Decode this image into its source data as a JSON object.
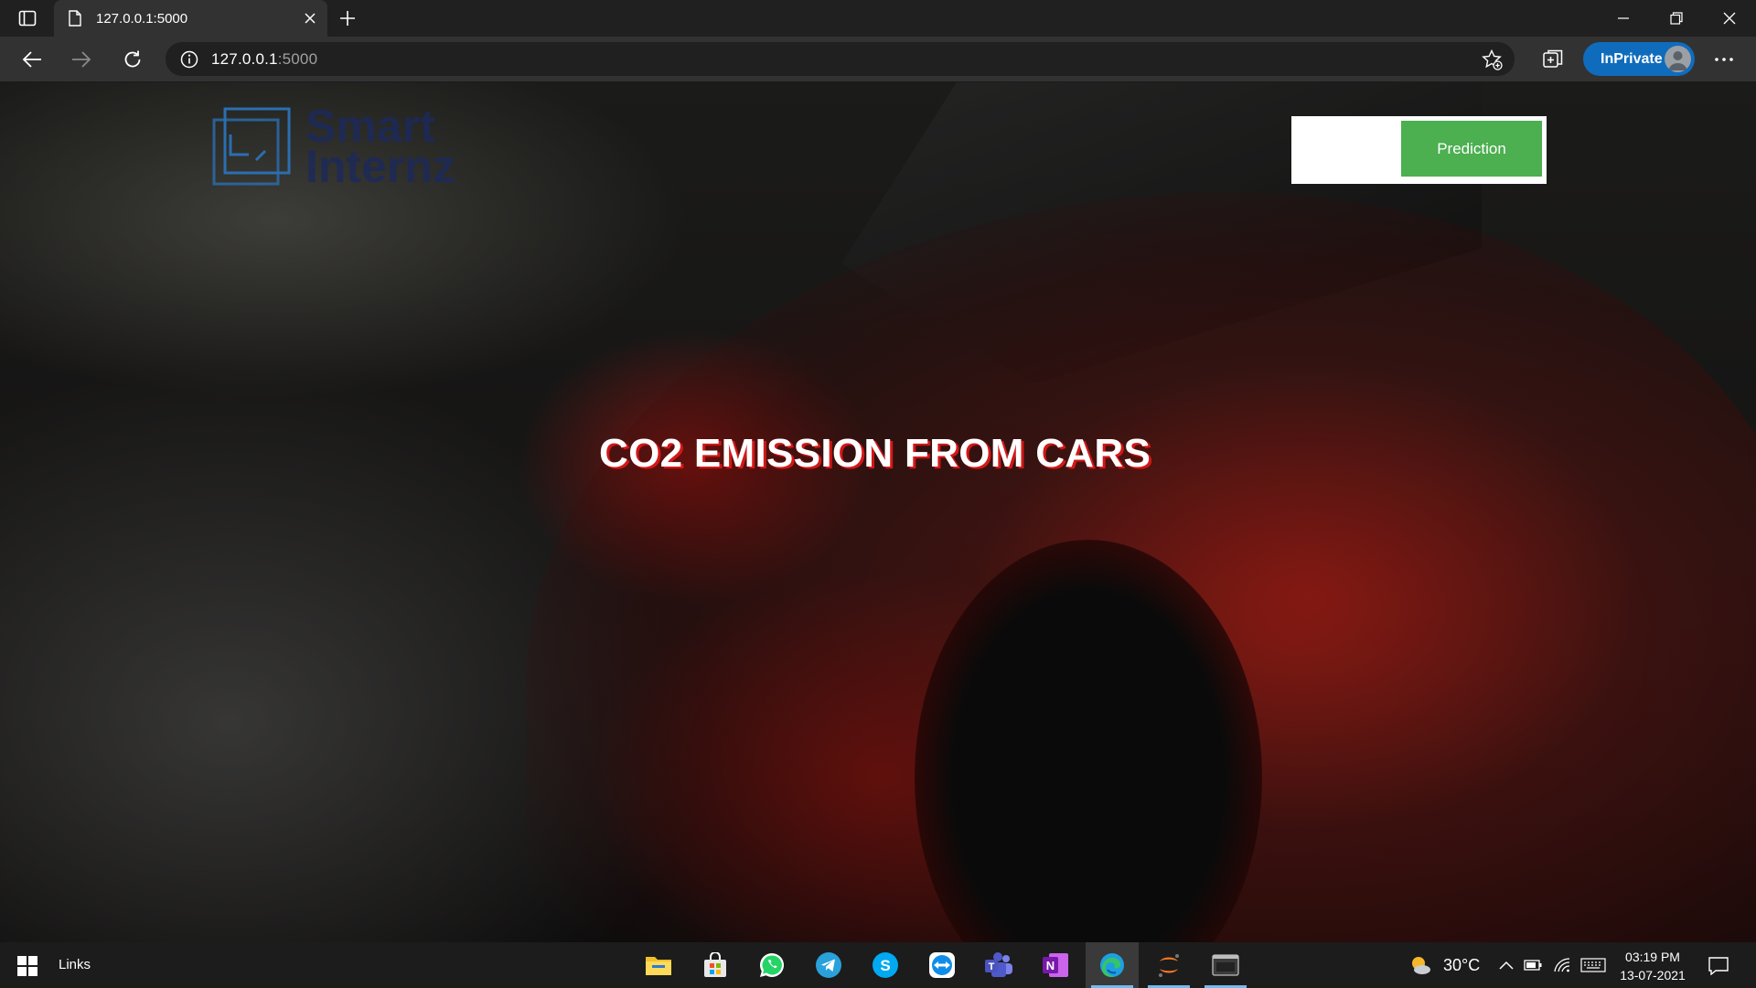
{
  "browser": {
    "tab_title": "127.0.0.1:5000",
    "url_host": "127.0.0.1",
    "url_port": ":5000",
    "inprivate_label": "InPrivate"
  },
  "page": {
    "logo_text_line1": "Smart",
    "logo_text_line2": "Internz",
    "nav_button_label": "Prediction",
    "hero_title": "CO2 EMISSION FROM CARS",
    "colors": {
      "button_bg": "#4caf50",
      "title_shadow": "#d11818",
      "logo_accent": "#2a6fb0"
    }
  },
  "taskbar": {
    "links_label": "Links",
    "apps": [
      "file-explorer",
      "microsoft-store",
      "whatsapp",
      "telegram",
      "skype",
      "teamviewer",
      "teams",
      "onenote",
      "edge",
      "jupyter",
      "terminal"
    ],
    "temperature": "30°C",
    "time": "03:19 PM",
    "date": "13-07-2021"
  }
}
